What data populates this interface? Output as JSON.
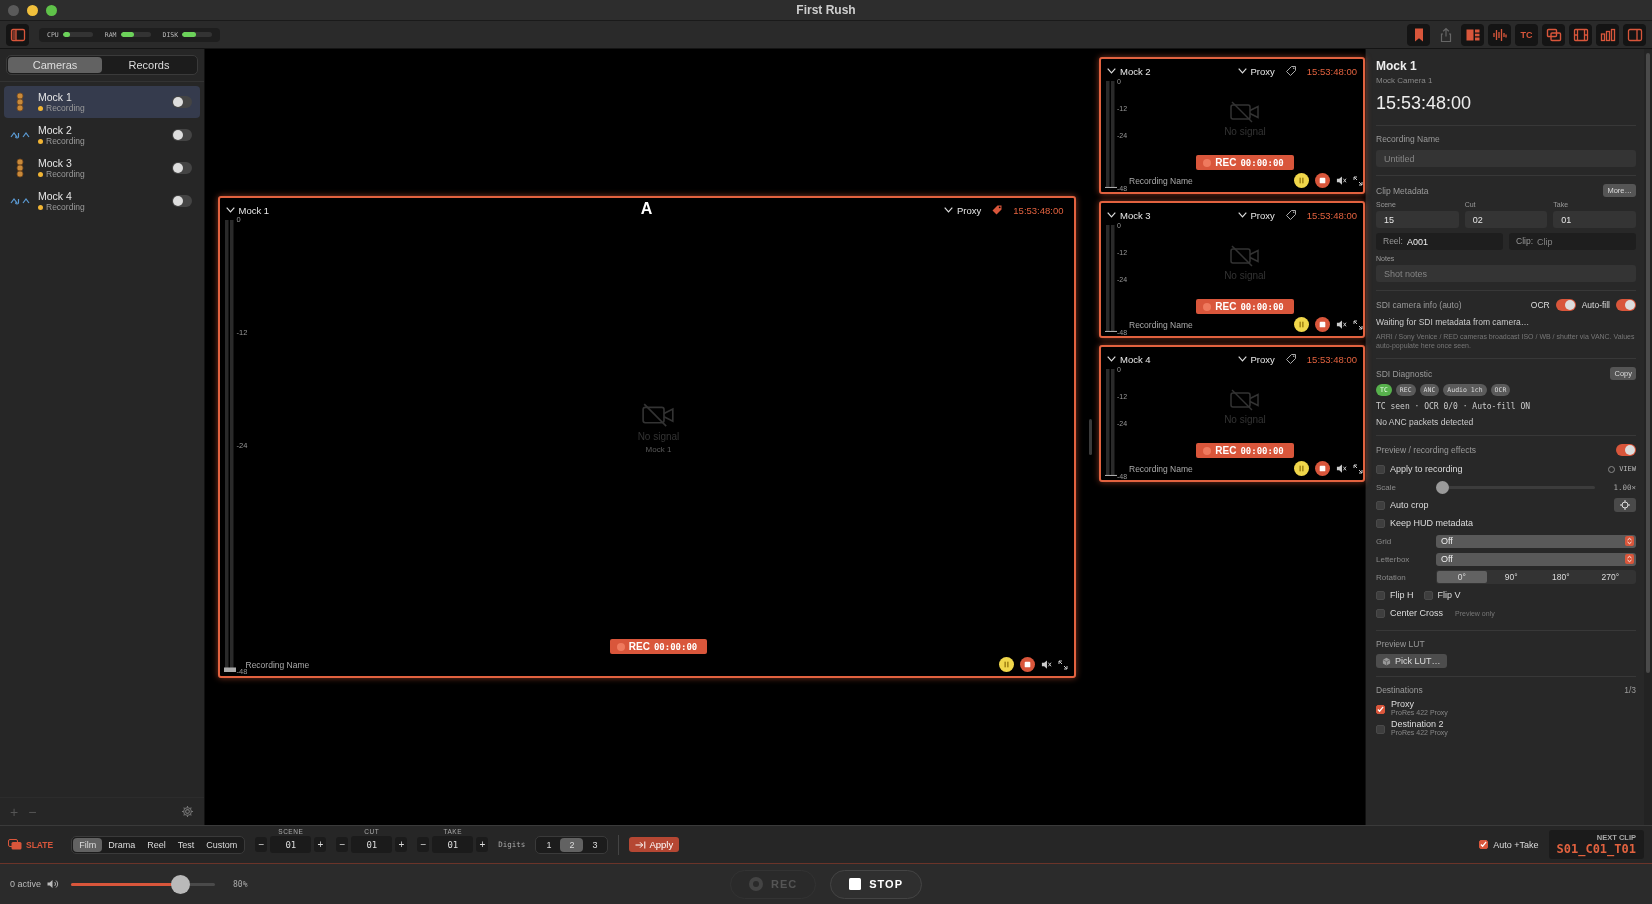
{
  "window": {
    "title": "First Rush"
  },
  "toolbar": {
    "sidebar_toggle": {
      "active": true
    },
    "meters": [
      {
        "label": "CPU",
        "level": 0.25
      },
      {
        "label": "RAM",
        "level": 0.45
      },
      {
        "label": "DISK",
        "level": 0.45
      }
    ],
    "tools": [
      {
        "kind": "bookmark",
        "active": true
      },
      {
        "kind": "share",
        "active": false
      },
      {
        "kind": "panels",
        "active": true
      },
      {
        "kind": "waveform",
        "active": true
      },
      {
        "kind": "tc",
        "label": "TC",
        "active": true
      },
      {
        "kind": "windows",
        "active": true
      },
      {
        "kind": "film",
        "active": true
      },
      {
        "kind": "bars",
        "active": true
      },
      {
        "kind": "sidebar",
        "active": true
      }
    ]
  },
  "sidebar": {
    "tabs": [
      {
        "label": "Cameras",
        "selected": true
      },
      {
        "label": "Records",
        "selected": false
      }
    ],
    "cameras": [
      {
        "name": "Mock 1",
        "status": "Recording",
        "kind": "stack",
        "selected": true,
        "on": false
      },
      {
        "name": "Mock 2",
        "status": "Recording",
        "kind": "wave",
        "selected": false,
        "on": false
      },
      {
        "name": "Mock 3",
        "status": "Recording",
        "kind": "stack",
        "selected": false,
        "on": false
      },
      {
        "name": "Mock 4",
        "status": "Recording",
        "kind": "wave",
        "selected": false,
        "on": false
      }
    ],
    "footer_actions": [
      "+",
      "−"
    ]
  },
  "tiles": [
    {
      "kind": "main",
      "name": "Mock 1",
      "letter": "A",
      "destination": "Proxy",
      "tagged": true,
      "timecode": "15:53:48:00",
      "meter_ticks": [
        "0",
        "-12",
        "-24",
        "-48"
      ],
      "no_signal": "No signal",
      "source": "Mock 1",
      "rec": "REC",
      "rec_time": "00:00:00",
      "recording_name": "Recording Name"
    },
    {
      "kind": "thumb",
      "name": "Mock 2",
      "destination": "Proxy",
      "tagged": false,
      "timecode": "15:53:48:00",
      "meter_ticks": [
        "0",
        "-12",
        "-24",
        "-48"
      ],
      "no_signal": "No signal",
      "rec": "REC",
      "rec_time": "00:00:00",
      "recording_name": "Recording Name"
    },
    {
      "kind": "thumb",
      "name": "Mock 3",
      "destination": "Proxy",
      "tagged": false,
      "timecode": "15:53:48:00",
      "meter_ticks": [
        "0",
        "-12",
        "-24",
        "-48"
      ],
      "no_signal": "No signal",
      "rec": "REC",
      "rec_time": "00:00:00",
      "recording_name": "Recording Name"
    },
    {
      "kind": "thumb",
      "name": "Mock 4",
      "destination": "Proxy",
      "tagged": false,
      "timecode": "15:53:48:00",
      "meter_ticks": [
        "0",
        "-12",
        "-24",
        "-48"
      ],
      "no_signal": "No signal",
      "rec": "REC",
      "rec_time": "00:00:00",
      "recording_name": "Recording Name"
    }
  ],
  "inspector": {
    "title": "Mock 1",
    "subtitle": "Mock Camera 1",
    "timecode": "15:53:48:00",
    "recording_name": {
      "label": "Recording Name",
      "placeholder": "Untitled"
    },
    "clip_metadata": {
      "title": "Clip Metadata",
      "more": "More…",
      "fields": [
        {
          "label": "Scene",
          "value": "15"
        },
        {
          "label": "Cut",
          "value": "02"
        },
        {
          "label": "Take",
          "value": "01"
        }
      ],
      "reel": {
        "label": "Reel:",
        "value": "A001"
      },
      "clip": {
        "label": "Clip:",
        "placeholder": "Clip"
      },
      "notes": {
        "label": "Notes",
        "placeholder": "Shot notes"
      }
    },
    "sdi_info": {
      "title": "SDI camera info (auto)",
      "toggles": [
        {
          "label": "OCR",
          "on": true
        },
        {
          "label": "Auto-fill",
          "on": true
        }
      ],
      "status": "Waiting for SDI metadata from camera…",
      "note": "ARRI / Sony Venice / RED cameras broadcast ISO / WB / shutter via VANC. Values auto-populate here once seen."
    },
    "sdi_diagnostic": {
      "title": "SDI Diagnostic",
      "copy": "Copy",
      "badges": [
        {
          "label": "TC",
          "on": true
        },
        {
          "label": "REC",
          "on": false
        },
        {
          "label": "ANC",
          "on": false
        },
        {
          "label": "Audio 1ch",
          "on": false
        },
        {
          "label": "OCR",
          "on": false
        }
      ],
      "summary": "TC seen · OCR 0/0 · Auto-fill ON",
      "status": "No ANC packets detected"
    },
    "effects": {
      "title": "Preview / recording effects",
      "on": true,
      "apply": {
        "label": "Apply to recording",
        "checked": false
      },
      "view": {
        "label": "VIEW",
        "selected": false
      },
      "scale": {
        "label": "Scale",
        "level": 0,
        "reading": "1.00×"
      },
      "auto_crop": {
        "label": "Auto crop",
        "checked": false
      },
      "keep_hud": {
        "label": "Keep HUD metadata",
        "checked": false
      },
      "grid": {
        "label": "Grid",
        "value": "Off"
      },
      "letterbox": {
        "label": "Letterbox",
        "value": "Off"
      },
      "rotation": {
        "label": "Rotation",
        "options": [
          {
            "label": "0°",
            "selected": true
          },
          {
            "label": "90°",
            "selected": false
          },
          {
            "label": "180°",
            "selected": false
          },
          {
            "label": "270°",
            "selected": false
          }
        ]
      },
      "flips": [
        {
          "label": "Flip H",
          "checked": false
        },
        {
          "label": "Flip V",
          "checked": false
        }
      ],
      "center_cross": {
        "label": "Center Cross",
        "checked": false,
        "note": "Preview only"
      }
    },
    "lut": {
      "title": "Preview LUT",
      "button": "Pick LUT…"
    },
    "destinations": {
      "title": "Destinations",
      "count": "1/3",
      "items": [
        {
          "name": "Proxy",
          "format": "ProRes 422 Proxy",
          "checked": true
        },
        {
          "name": "Destination 2",
          "format": "ProRes 422 Proxy",
          "checked": false
        }
      ]
    }
  },
  "slate": {
    "label": "SLATE",
    "presets": [
      {
        "label": "Film",
        "selected": true
      },
      {
        "label": "Drama",
        "selected": false
      },
      {
        "label": "Reel",
        "selected": false
      },
      {
        "label": "Test",
        "selected": false
      },
      {
        "label": "Custom",
        "selected": false
      }
    ],
    "counters": [
      {
        "label": "SCENE",
        "value": "01",
        "decrement": "−",
        "increment": "+"
      },
      {
        "label": "CUT",
        "value": "01",
        "decrement": "−",
        "increment": "+"
      },
      {
        "label": "TAKE",
        "value": "01",
        "decrement": "−",
        "increment": "+"
      }
    ],
    "digits": {
      "label": "Digits",
      "options": [
        {
          "label": "1",
          "selected": false
        },
        {
          "label": "2",
          "selected": true
        },
        {
          "label": "3",
          "selected": false
        }
      ]
    },
    "apply": "Apply",
    "auto_take": {
      "label": "Auto +Take",
      "checked": true
    },
    "next_clip": {
      "label": "NEXT CLIP",
      "value": "S01_C01_T01"
    }
  },
  "transport": {
    "active": "0 active",
    "volume": {
      "level": 0.8,
      "reading": "80%"
    },
    "rec": {
      "label": "REC",
      "disabled": true
    },
    "stop": {
      "label": "STOP",
      "disabled": false
    }
  }
}
